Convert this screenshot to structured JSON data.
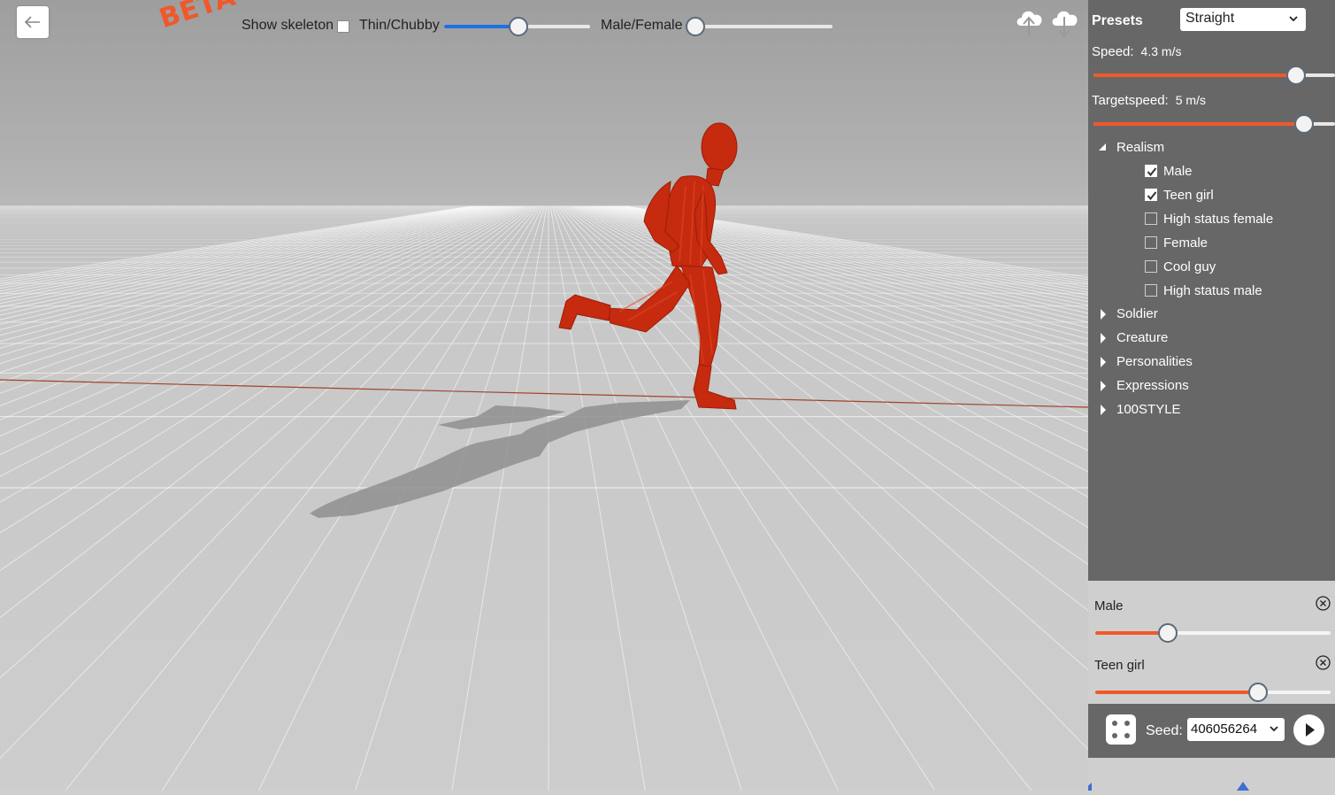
{
  "toolbar": {
    "badge": "BETA",
    "show_skeleton_label": "Show skeleton",
    "show_skeleton_checked": false,
    "thin_chubby_label": "Thin/Chubby",
    "thin_chubby_value": 0.51,
    "male_female_label": "Male/Female",
    "male_female_value": 0.0
  },
  "presets": {
    "title": "Presets",
    "selected": "Straight",
    "speed": {
      "label": "Speed:",
      "value": "4.3",
      "unit": "m/s",
      "slider": 0.84
    },
    "targetspeed": {
      "label": "Targetspeed:",
      "value": "5",
      "unit": "m/s",
      "slider": 0.87
    },
    "groups": [
      {
        "label": "Realism",
        "expanded": true,
        "items": [
          {
            "label": "Male",
            "checked": true
          },
          {
            "label": "Teen girl",
            "checked": true
          },
          {
            "label": "High status female",
            "checked": false
          },
          {
            "label": "Female",
            "checked": false
          },
          {
            "label": "Cool guy",
            "checked": false
          },
          {
            "label": "High status male",
            "checked": false
          }
        ]
      },
      {
        "label": "Soldier",
        "expanded": false
      },
      {
        "label": "Creature",
        "expanded": false
      },
      {
        "label": "Personalities",
        "expanded": false
      },
      {
        "label": "Expressions",
        "expanded": false
      },
      {
        "label": "100STYLE",
        "expanded": false
      }
    ]
  },
  "mixer": [
    {
      "label": "Male",
      "weight": 0.31
    },
    {
      "label": "Teen girl",
      "weight": 0.69
    }
  ],
  "seed": {
    "label": "Seed:",
    "value": "406056264"
  },
  "colors": {
    "accent_orange": "#f0582a",
    "accent_blue": "#1f6fe5",
    "panel_bg": "#676767",
    "character": "#c62a0f"
  },
  "icons": [
    "back-arrow-icon",
    "cloud-upload-icon",
    "cloud-download-icon",
    "dice-icon",
    "play-icon",
    "close-circle-icon",
    "chevron-down-icon"
  ]
}
